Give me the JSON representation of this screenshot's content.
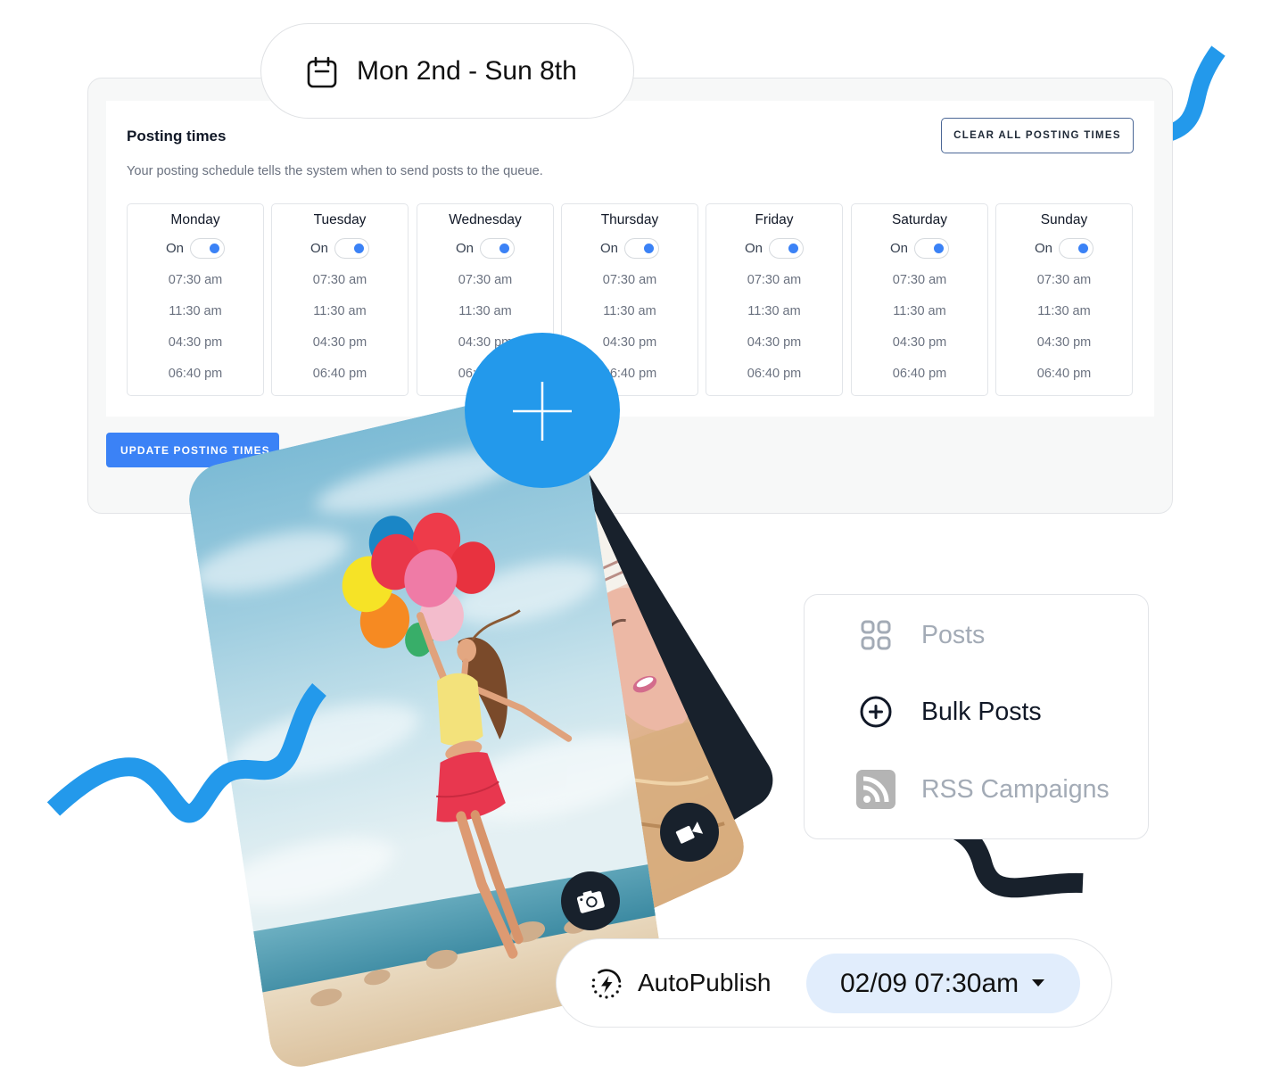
{
  "date_range": {
    "icon": "calendar-icon",
    "label": "Mon 2nd - Sun 8th"
  },
  "posting_times": {
    "title": "Posting times",
    "description": "Your posting schedule tells the system when to send posts to the queue.",
    "clear_button": "CLEAR ALL POSTING TIMES",
    "update_button": "UPDATE POSTING TIMES",
    "days": [
      {
        "name": "Monday",
        "status": "On",
        "enabled": true,
        "times": [
          "07:30 am",
          "11:30 am",
          "04:30 pm",
          "06:40 pm"
        ]
      },
      {
        "name": "Tuesday",
        "status": "On",
        "enabled": true,
        "times": [
          "07:30 am",
          "11:30 am",
          "04:30 pm",
          "06:40 pm"
        ]
      },
      {
        "name": "Wednesday",
        "status": "On",
        "enabled": true,
        "times": [
          "07:30 am",
          "11:30 am",
          "04:30 pm",
          "06:40 pm"
        ]
      },
      {
        "name": "Thursday",
        "status": "On",
        "enabled": true,
        "times": [
          "07:30 am",
          "11:30 am",
          "04:30 pm",
          "06:40 pm"
        ]
      },
      {
        "name": "Friday",
        "status": "On",
        "enabled": true,
        "times": [
          "07:30 am",
          "11:30 am",
          "04:30 pm",
          "06:40 pm"
        ]
      },
      {
        "name": "Saturday",
        "status": "On",
        "enabled": true,
        "times": [
          "07:30 am",
          "11:30 am",
          "04:30 pm",
          "06:40 pm"
        ]
      },
      {
        "name": "Sunday",
        "status": "On",
        "enabled": true,
        "times": [
          "07:30 am",
          "11:30 am",
          "04:30 pm",
          "06:40 pm"
        ]
      }
    ]
  },
  "media": {
    "add_button_icon": "plus-icon",
    "photo_badge_icon": "camera-icon",
    "video_badge_icon": "video-camera-icon"
  },
  "menu": {
    "items": [
      {
        "icon": "grid-icon",
        "label": "Posts",
        "active": false
      },
      {
        "icon": "plus-circle-icon",
        "label": "Bulk Posts",
        "active": true
      },
      {
        "icon": "rss-icon",
        "label": "RSS Campaigns",
        "active": false
      }
    ]
  },
  "autopublish": {
    "icon": "lightning-icon",
    "label": "AutoPublish",
    "datetime": "02/09 07:30am",
    "caret_icon": "caret-down-icon"
  },
  "colors": {
    "accent": "#2399eb",
    "primary_button": "#3b82f6",
    "toggle_on": "#3b82f6",
    "dark": "#18212c",
    "datetime_bg": "#e1edfc",
    "menu_inactive": "#a3abb6",
    "menu_active": "#111827"
  }
}
